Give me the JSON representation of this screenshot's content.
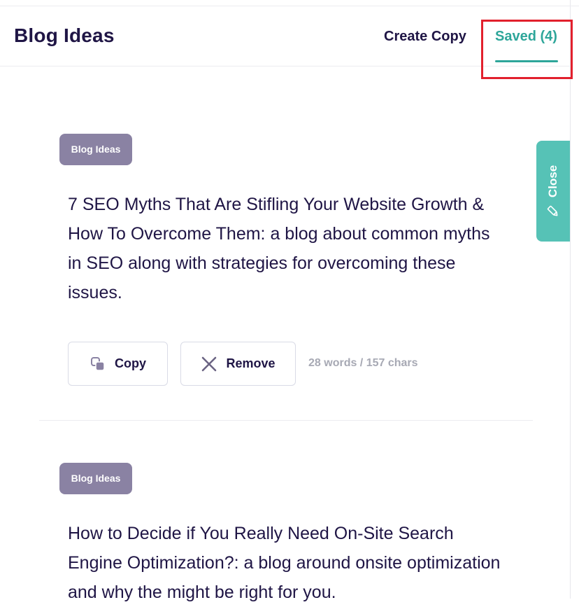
{
  "header": {
    "title": "Blog Ideas",
    "tabs": [
      {
        "label": "Create Copy",
        "active": false
      },
      {
        "label": "Saved (4)",
        "active": true
      }
    ]
  },
  "side_tab": {
    "label": "Close",
    "icon": "pencil-icon"
  },
  "colors": {
    "accent": "#2ea69a",
    "side_tab": "#56c2b6",
    "tag": "#8a82a3",
    "text": "#1f1545",
    "muted": "#a7a9b4",
    "highlight": "#e2202d"
  },
  "ideas": [
    {
      "tag": "Blog Ideas",
      "text": "7 SEO Myths That Are Stifling Your Website Growth & How To Overcome Them: a blog about common myths in SEO along with strategies for overcoming these issues.",
      "copy_label": "Copy",
      "remove_label": "Remove",
      "stats": "28 words / 157 chars"
    },
    {
      "tag": "Blog Ideas",
      "text": "How to Decide if You Really Need On-Site Search Engine Optimization?: a blog around onsite optimization and why the might be right for you."
    }
  ]
}
